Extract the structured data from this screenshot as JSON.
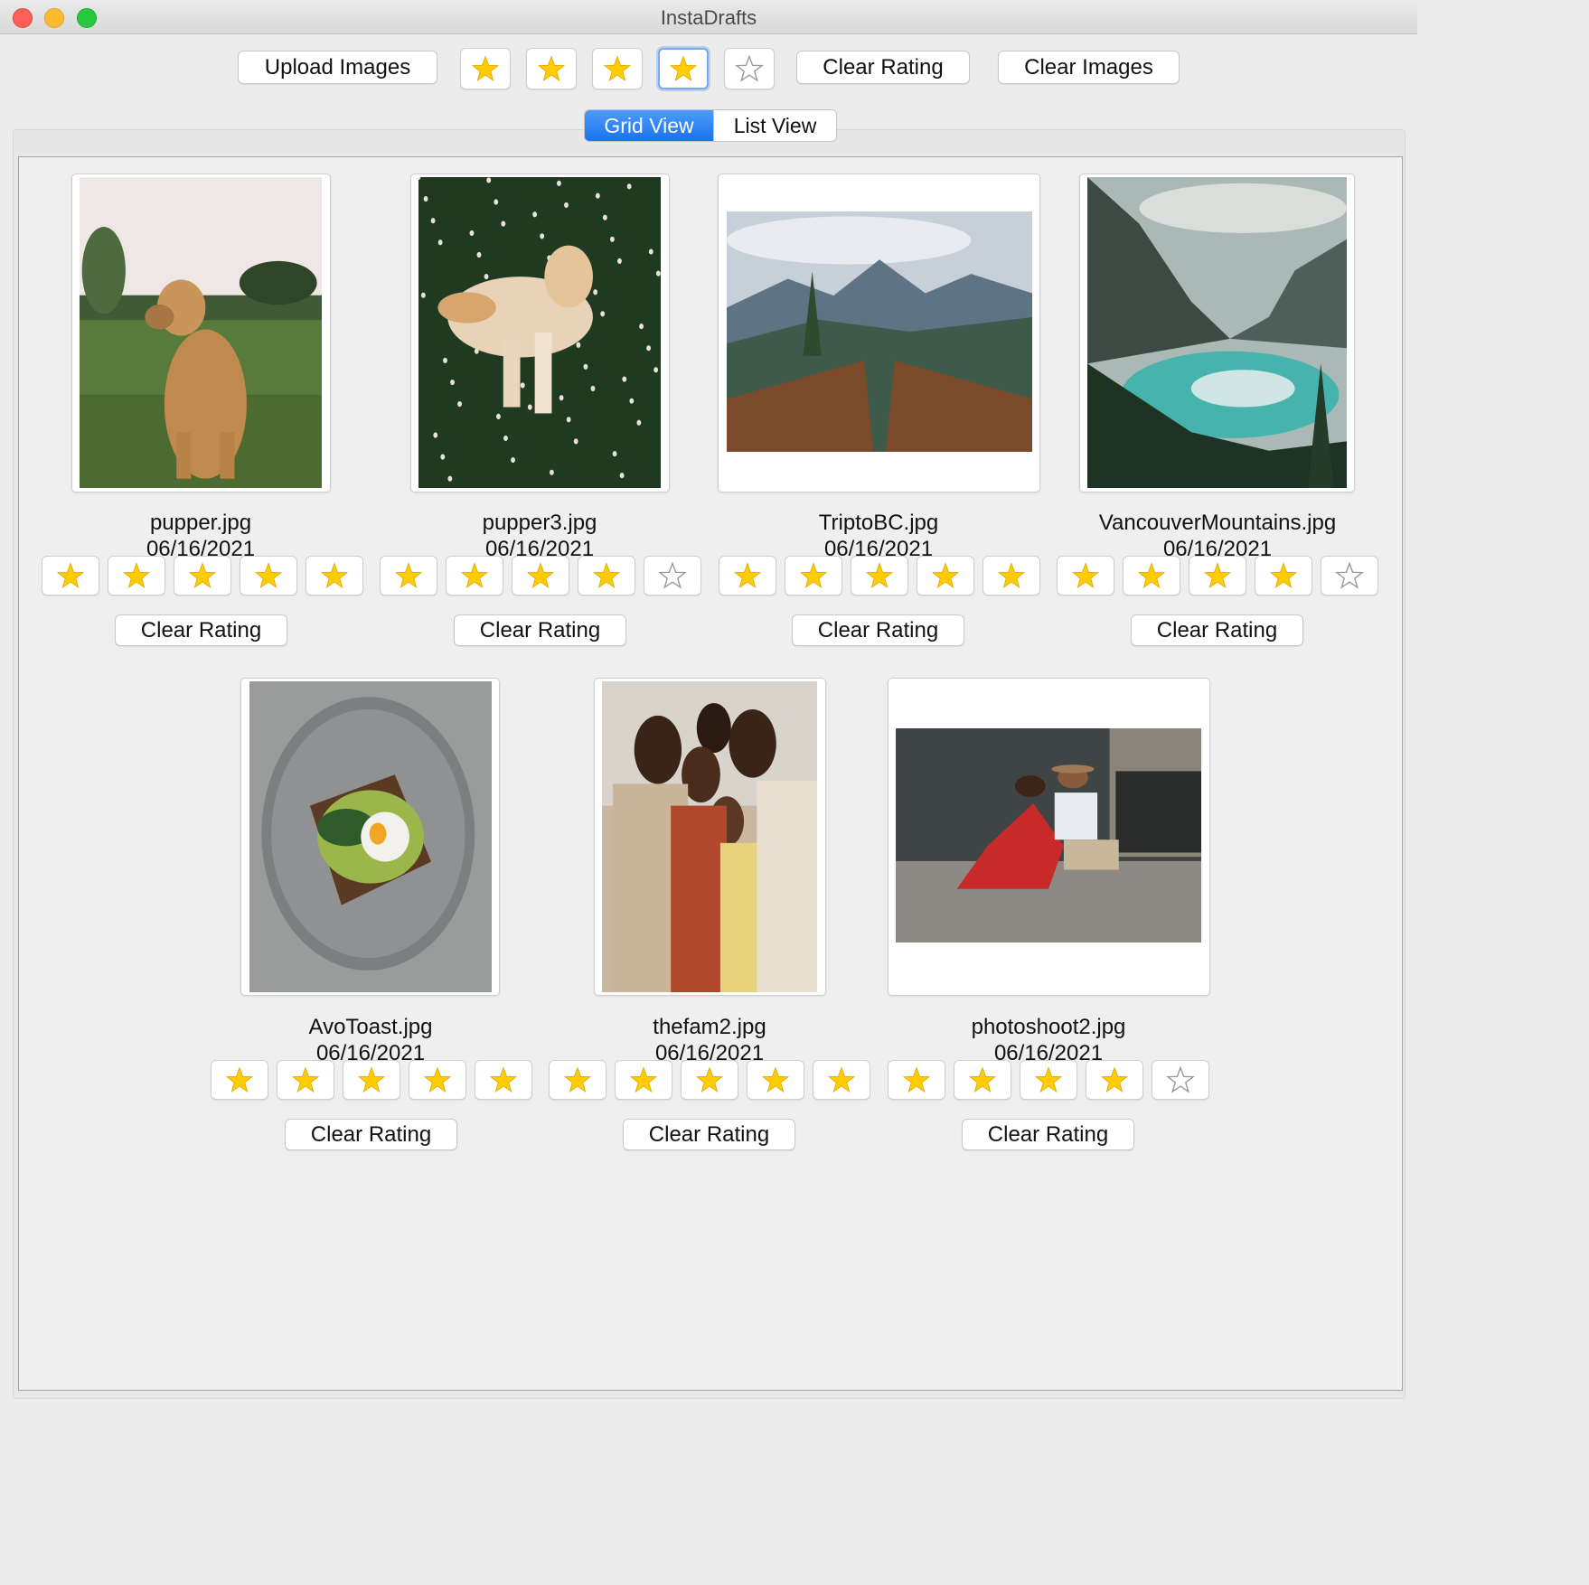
{
  "window": {
    "title": "InstaDrafts"
  },
  "toolbar": {
    "upload_label": "Upload Images",
    "clear_rating_label": "Clear Rating",
    "clear_images_label": "Clear Images",
    "filter_stars": [
      true,
      true,
      true,
      true,
      false
    ],
    "focused_star_index": 3
  },
  "tabs": [
    {
      "label": "Grid View",
      "selected": true
    },
    {
      "label": "List View",
      "selected": false
    }
  ],
  "colors": {
    "accent": "#1a73ec",
    "star_filled": "#ffcc00",
    "star_outline": "#9a9a9a"
  },
  "images": [
    {
      "filename": "pupper.jpg",
      "date": "06/16/2021",
      "rating": 5,
      "clear_label": "Clear Rating",
      "subject": "golden-retriever-on-grass"
    },
    {
      "filename": "pupper3.jpg",
      "date": "06/16/2021",
      "rating": 4,
      "clear_label": "Clear Rating",
      "subject": "golden-retriever-in-clover"
    },
    {
      "filename": "TriptoBC.jpg",
      "date": "06/16/2021",
      "rating": 5,
      "clear_label": "Clear Rating",
      "subject": "mountain-valley-railing"
    },
    {
      "filename": "VancouverMountains.jpg",
      "date": "06/16/2021",
      "rating": 4,
      "clear_label": "Clear Rating",
      "subject": "turquoise-mountain-lake"
    },
    {
      "filename": "AvoToast.jpg",
      "date": "06/16/2021",
      "rating": 5,
      "clear_label": "Clear Rating",
      "subject": "avocado-toast-with-egg"
    },
    {
      "filename": "thefam2.jpg",
      "date": "06/16/2021",
      "rating": 5,
      "clear_label": "Clear Rating",
      "subject": "family-group-hug"
    },
    {
      "filename": "photoshoot2.jpg",
      "date": "06/16/2021",
      "rating": 4,
      "clear_label": "Clear Rating",
      "subject": "couple-sitting-on-street"
    }
  ]
}
